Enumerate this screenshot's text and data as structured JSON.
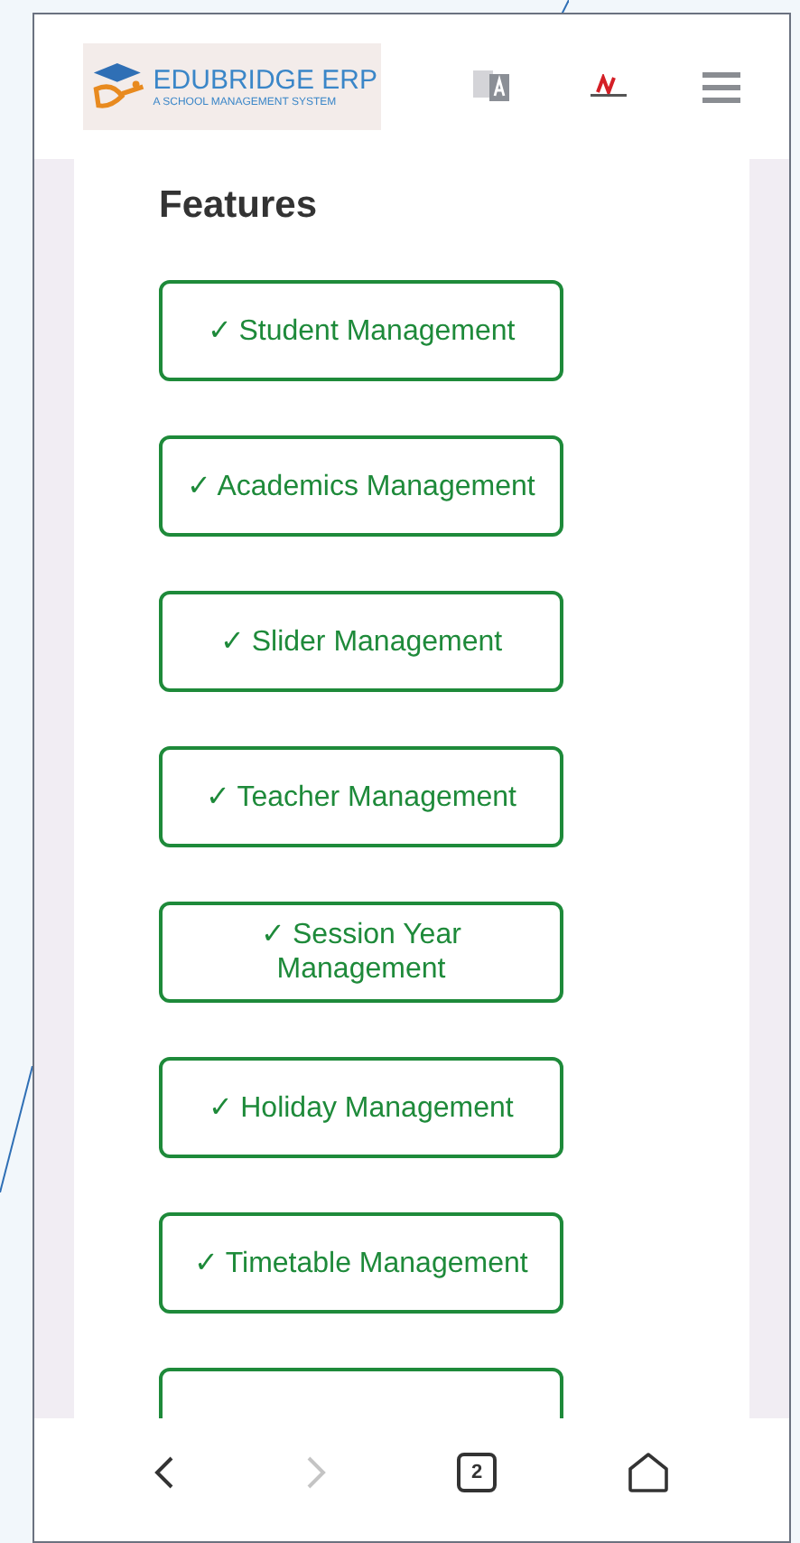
{
  "header": {
    "logo_title": "EDUBRIDGE ERP",
    "logo_subtitle": "A SCHOOL MANAGEMENT SYSTEM"
  },
  "section": {
    "title": "Features",
    "items": [
      {
        "label": "✓ Student Management"
      },
      {
        "label": "✓ Academics Management"
      },
      {
        "label": "✓ Slider Management"
      },
      {
        "label": "✓ Teacher Management"
      },
      {
        "label": "✓ Session Year Management"
      },
      {
        "label": "✓ Holiday Management"
      },
      {
        "label": "✓ Timetable Management"
      }
    ]
  },
  "browser_bar": {
    "tab_count": "2",
    "forward_disabled": true
  }
}
